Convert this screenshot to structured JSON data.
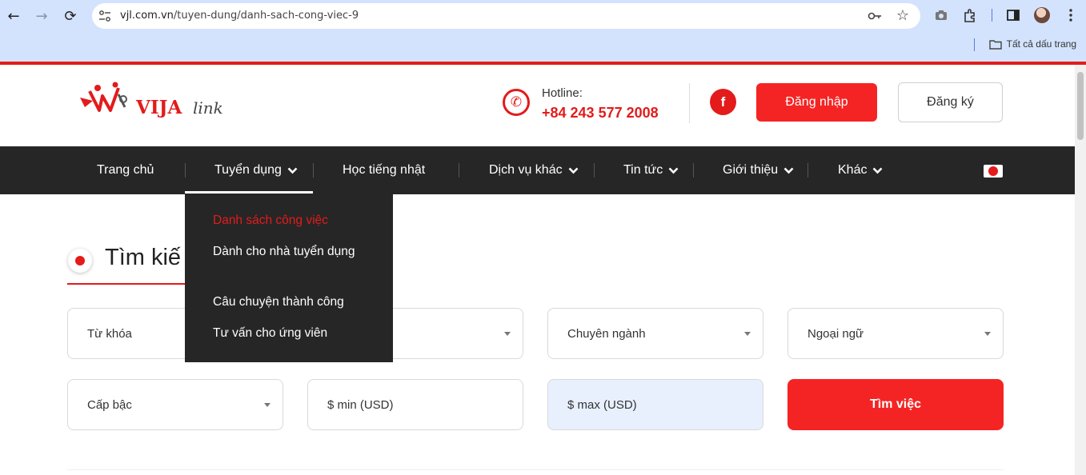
{
  "browser": {
    "url_host": "vjl.com.vn",
    "url_path": "/tuyen-dung/danh-sach-cong-viec-9",
    "bookmarks_label": "Tất cả dấu trang"
  },
  "header": {
    "brand": "VIJA",
    "brand_suffix": "link",
    "hotline_label": "Hotline:",
    "hotline_number": "+84 243 577 2008",
    "facebook_glyph": "f",
    "login_label": "Đăng nhập",
    "signup_label": "Đăng ký"
  },
  "nav": {
    "items": [
      {
        "label": "Trang chủ"
      },
      {
        "label": "Tuyển dụng"
      },
      {
        "label": "Học tiếng nhật"
      },
      {
        "label": "Dịch vụ khác"
      },
      {
        "label": "Tin tức"
      },
      {
        "label": "Giới thiệu"
      },
      {
        "label": "Khác"
      }
    ]
  },
  "dropdown": {
    "items": [
      {
        "label": "Danh sách công việc"
      },
      {
        "label": "Dành cho nhà tuyển dụng"
      },
      {
        "label": "Câu chuyện thành công"
      },
      {
        "label": "Tư vấn cho ứng viên"
      }
    ]
  },
  "search": {
    "title": "Tìm kiế",
    "keyword_label": "Từ khóa",
    "major_label": "Chuyên ngành",
    "language_label": "Ngoại ngữ",
    "level_label": "Cấp bậc",
    "min_placeholder": "$ min (USD)",
    "max_placeholder": "$ max (USD)",
    "submit_label": "Tìm việc"
  },
  "colors": {
    "accent": "#e31b1b",
    "nav_bg": "#262626",
    "chrome_bg": "#d3e3fd"
  }
}
